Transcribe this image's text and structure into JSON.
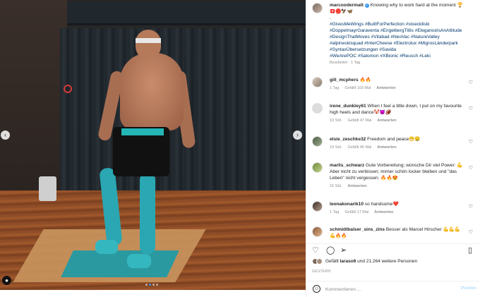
{
  "post": {
    "username": "marcoodermatt",
    "caption_text": "Knowing why to work hard at the moment 🏆",
    "caption_emojis": "🇨🇭🛑🦅🦋",
    "caption_dot": ".",
    "hashtags_line1": "#GivesMeWings #BuiltForPerfection #stoeckliski",
    "hashtags_line2": "#DoppelmayrGaraventa #EngelbergTitlis #EleganceIsAnAttitude",
    "hashtags_line3": "#DesignThatMoves #Vitabad #NeoVac #NatureValley",
    "hashtags_line4": "#alpineskisquad #InterCheese #Electrolux #MigrosLänderpark",
    "hashtags_line5": "#SyntaxÜbersetzungen #Savida",
    "hashtags_line6": "#WeArePOC #Salomon #XBionic #Reusch #Leki",
    "edited": "Bearbeitet · 1 Tag"
  },
  "comments": [
    {
      "user": "gill_mcphers",
      "text": "🔥🔥",
      "time": "1 Tag",
      "likes": "Gefällt 103 Mal",
      "reply": "Antworten"
    },
    {
      "user": "irene_dunkley61",
      "text": "When I feel a little down, I put on my favourite high heels and dance🤡😈🏈",
      "time": "19 Std.",
      "likes": "Gefällt 47 Mal",
      "reply": "Antworten"
    },
    {
      "user": "elsie_zeschke32",
      "text": "Freedom and peace😁🤤",
      "time": "19 Std.",
      "likes": "Gefällt 46 Mal",
      "reply": "Antworten"
    },
    {
      "user": "marlis_schwarz",
      "text": "Gute Vorbereitung; wünsche Dir viel Power: 💪 Aber nicht zu verbissen; immer schön locker bleiben und \"das Leben\" nicht vergessen. 🔥🔥😍",
      "time": "15 Std.",
      "likes": "",
      "reply": "Antworten"
    },
    {
      "user": "leonakonarik10",
      "text": "so handsome❤️",
      "time": "1 Tag",
      "likes": "Gefällt 17 Mal",
      "reply": "Antworten"
    },
    {
      "user": "schmidtbalser_sins_zins",
      "text": "Besser als Marcel Hirscher 💪💪💪💪🔥🔥",
      "time": "",
      "likes": "",
      "reply": ""
    }
  ],
  "actions": {
    "like_icon": "heart-icon",
    "comment_icon": "comment-icon",
    "share_icon": "share-icon",
    "save_icon": "bookmark-icon"
  },
  "likes_text_prefix": "Gefällt ",
  "likes_user": "laraso6",
  "likes_text_suffix": " und 21.264 weitere Personen",
  "date": "GESTERN",
  "comment_box": {
    "placeholder": "Kommentieren ...",
    "post_label": "Posten"
  },
  "nav": {
    "prev": "‹",
    "next": "›"
  },
  "colors": {
    "link": "#00376b",
    "accent": "#3897f0",
    "post_disabled": "#b2dffc"
  }
}
